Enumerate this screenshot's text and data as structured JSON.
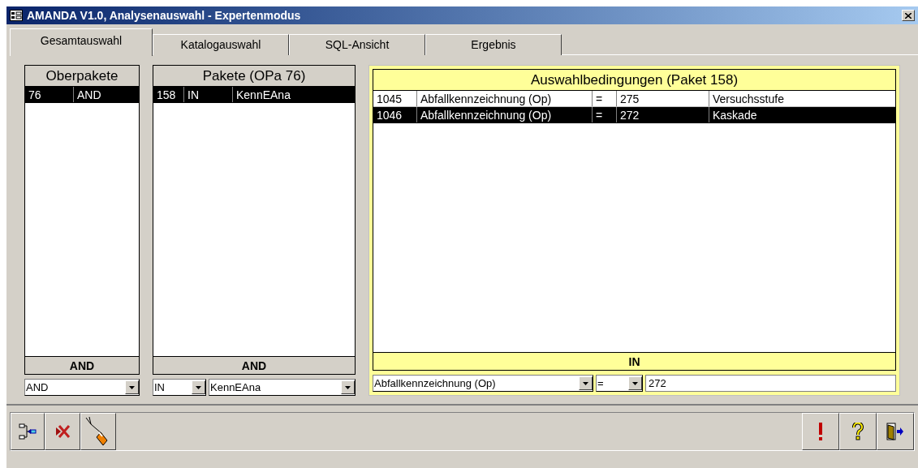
{
  "window": {
    "title": "AMANDA V1.0, Analysenauswahl - Expertenmodus"
  },
  "tabs": [
    {
      "label": "Gesamtauswahl",
      "selected": true
    },
    {
      "label": "Katalogauswahl",
      "selected": false
    },
    {
      "label": "SQL-Ansicht",
      "selected": false
    },
    {
      "label": "Ergebnis",
      "selected": false
    }
  ],
  "panels": [
    {
      "title": "Oberpakete",
      "highlight": false,
      "rows": [
        {
          "cells": [
            "76",
            "AND"
          ],
          "selected": true
        }
      ],
      "footer": "AND",
      "controls": [
        {
          "kind": "combo",
          "value": "AND"
        }
      ]
    },
    {
      "title": "Pakete (OPa 76)",
      "highlight": false,
      "rows": [
        {
          "cells": [
            "158",
            "IN",
            "KennEAna"
          ],
          "selected": true
        }
      ],
      "footer": "AND",
      "controls": [
        {
          "kind": "combo",
          "value": "IN"
        },
        {
          "kind": "combo",
          "value": "KennEAna"
        }
      ]
    },
    {
      "title": "Auswahlbedingungen (Paket 158)",
      "highlight": true,
      "rows": [
        {
          "cells": [
            "1045",
            "Abfallkennzeichnung (Op)",
            "=",
            "275",
            "Versuchsstufe"
          ],
          "selected": false
        },
        {
          "cells": [
            "1046",
            "Abfallkennzeichnung (Op)",
            "=",
            "272",
            "Kaskade"
          ],
          "selected": true
        }
      ],
      "footer": "IN",
      "controls": [
        {
          "kind": "combo",
          "value": "Abfallkennzeichnung (Op)"
        },
        {
          "kind": "combo",
          "value": "="
        },
        {
          "kind": "text",
          "value": "272"
        }
      ]
    }
  ]
}
